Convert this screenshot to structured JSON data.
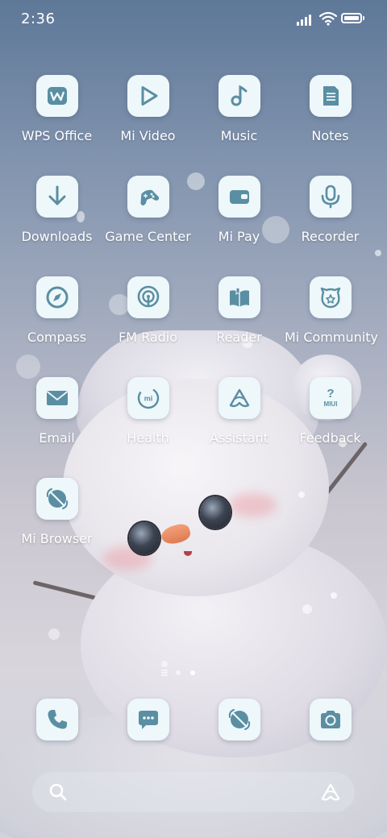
{
  "status_bar": {
    "time": "2:36"
  },
  "apps": [
    {
      "label": "WPS Office",
      "icon": "wps-office-icon"
    },
    {
      "label": "Mi Video",
      "icon": "play-icon"
    },
    {
      "label": "Music",
      "icon": "music-note-icon"
    },
    {
      "label": "Notes",
      "icon": "notes-icon"
    },
    {
      "label": "Downloads",
      "icon": "download-arrow-icon"
    },
    {
      "label": "Game Center",
      "icon": "gamepad-icon"
    },
    {
      "label": "Mi Pay",
      "icon": "wallet-icon"
    },
    {
      "label": "Recorder",
      "icon": "microphone-icon"
    },
    {
      "label": "Compass",
      "icon": "compass-icon"
    },
    {
      "label": "FM Radio",
      "icon": "radio-signal-icon"
    },
    {
      "label": "Reader",
      "icon": "book-icon"
    },
    {
      "label": "Mi Community",
      "icon": "mi-community-icon"
    },
    {
      "label": "Email",
      "icon": "envelope-icon"
    },
    {
      "label": "Health",
      "icon": "health-ring-icon",
      "icon_text": "mi"
    },
    {
      "label": "Assistant",
      "icon": "assistant-icon"
    },
    {
      "label": "Feedback",
      "icon": "feedback-question-icon",
      "icon_text": "MIUI"
    },
    {
      "label": "Mi Browser",
      "icon": "browser-icon"
    }
  ],
  "dock": [
    {
      "icon": "phone-icon"
    },
    {
      "icon": "messages-icon"
    },
    {
      "icon": "browser-icon"
    },
    {
      "icon": "camera-icon"
    }
  ],
  "pager": {
    "pages": 2,
    "active": 2
  },
  "search_bar": {
    "left_icon": "search-icon",
    "right_icon": "assistant-icon"
  },
  "colors": {
    "icon_glyph": "#5a8ea3",
    "icon_tile": "#eef7f9",
    "label_text": "#ffffff"
  }
}
